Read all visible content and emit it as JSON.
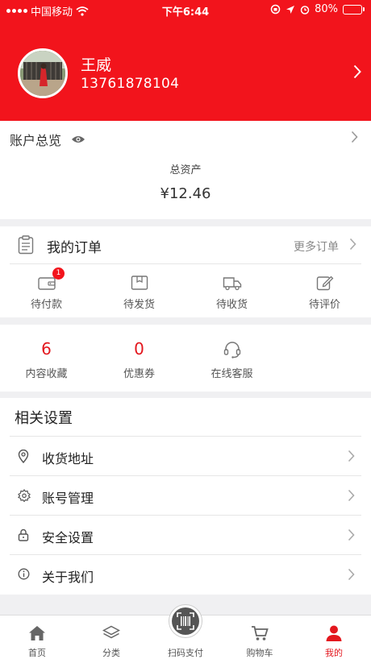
{
  "status_bar": {
    "carrier": "中国移动",
    "time": "下午6:44",
    "battery": "80%",
    "battery_level": 0.8
  },
  "profile": {
    "name": "王威",
    "phone": "13761878104"
  },
  "account": {
    "title": "账户总览",
    "total_label": "总资产",
    "total_value": "¥12.46"
  },
  "orders": {
    "title": "我的订单",
    "more": "更多订单",
    "items": [
      {
        "label": "待付款",
        "icon": "wallet-icon",
        "badge": "1"
      },
      {
        "label": "待发货",
        "icon": "package-icon"
      },
      {
        "label": "待收货",
        "icon": "truck-icon"
      },
      {
        "label": "待评价",
        "icon": "pencil-icon"
      }
    ]
  },
  "stats": [
    {
      "value": "6",
      "label": "内容收藏"
    },
    {
      "value": "0",
      "label": "优惠券"
    },
    {
      "label": "在线客服",
      "icon": "headset-icon"
    }
  ],
  "settings": {
    "title": "相关设置",
    "items": [
      {
        "label": "收货地址",
        "icon": "location-pin-icon"
      },
      {
        "label": "账号管理",
        "icon": "gear-icon"
      },
      {
        "label": "安全设置",
        "icon": "lock-icon"
      },
      {
        "label": "关于我们",
        "icon": "info-icon"
      }
    ]
  },
  "tabbar": {
    "items": [
      {
        "label": "首页",
        "icon": "home-icon"
      },
      {
        "label": "分类",
        "icon": "layers-icon"
      },
      {
        "label": "扫码支付",
        "icon": "barcode-scan-icon"
      },
      {
        "label": "购物车",
        "icon": "cart-icon"
      },
      {
        "label": "我的",
        "icon": "person-icon",
        "active": true
      }
    ]
  },
  "colors": {
    "brand_red": "#f2141c",
    "badge_red": "#f2141c",
    "number_red": "#e3171e"
  }
}
